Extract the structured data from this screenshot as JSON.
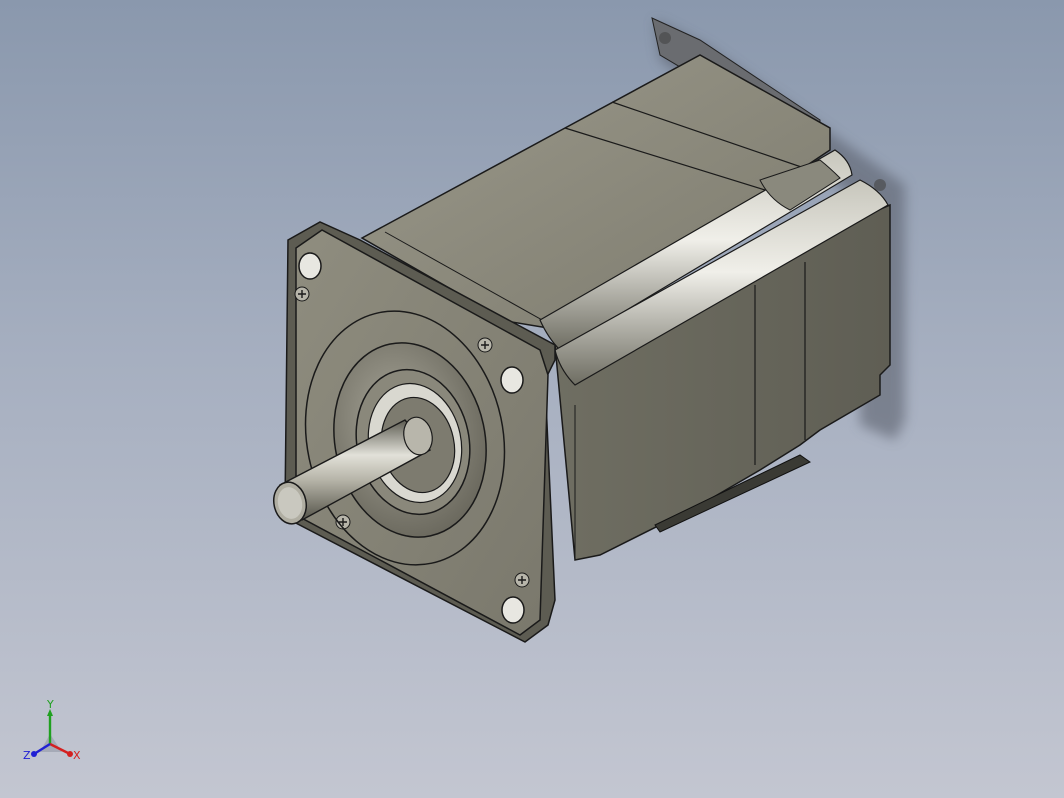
{
  "viewport": {
    "background_top": "#8a98ad",
    "background_bottom": "#c3c6d1"
  },
  "model": {
    "icon": "stepper-motor-3d-model",
    "body_color": "#8c8a7c",
    "edge_color": "#1a1a1a"
  },
  "triad": {
    "icon": "view-orientation-triad",
    "x_label": "X",
    "y_label": "Y",
    "z_label": "Z",
    "x_color": "#d42020",
    "y_color": "#1fa01f",
    "z_color": "#2020d4"
  }
}
